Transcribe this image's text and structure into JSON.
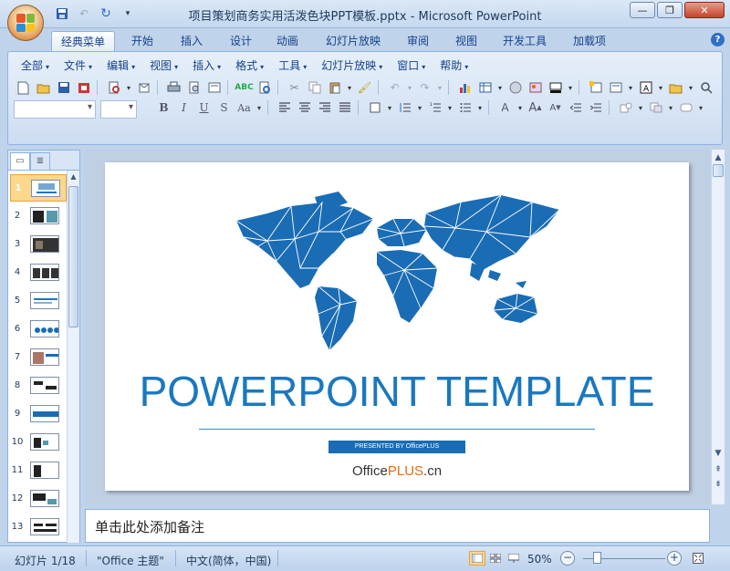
{
  "window": {
    "title": "项目策划商务实用活泼色块PPT模板.pptx - Microsoft PowerPoint",
    "minimize": "—",
    "restore": "❐",
    "close": "✕"
  },
  "tabs": [
    "经典菜单",
    "开始",
    "插入",
    "设计",
    "动画",
    "幻灯片放映",
    "审阅",
    "视图",
    "开发工具",
    "加载项"
  ],
  "help": "?",
  "menu": [
    "全部",
    "文件",
    "编辑",
    "视图",
    "插入",
    "格式",
    "工具",
    "幻灯片放映",
    "窗口",
    "帮助"
  ],
  "slides": {
    "count": 13,
    "numbers": [
      "1",
      "2",
      "3",
      "4",
      "5",
      "6",
      "7",
      "8",
      "9",
      "10",
      "11",
      "12",
      "13"
    ],
    "selected": "1"
  },
  "slide": {
    "title": "POWERPOINT TEMPLATE",
    "presented_by": "PRESENTED BY OfficePLUS",
    "brand_office": "Office",
    "brand_plus": "PLUS",
    "brand_tld": ".cn",
    "map_color": "#1a6cb5"
  },
  "notes": {
    "placeholder": "单击此处添加备注"
  },
  "status": {
    "slide_info": "幻灯片 1/18",
    "theme": "\"Office 主题\"",
    "language": "中文(简体，中国)",
    "zoom": "50%",
    "zoom_minus": "−",
    "zoom_plus": "+"
  }
}
